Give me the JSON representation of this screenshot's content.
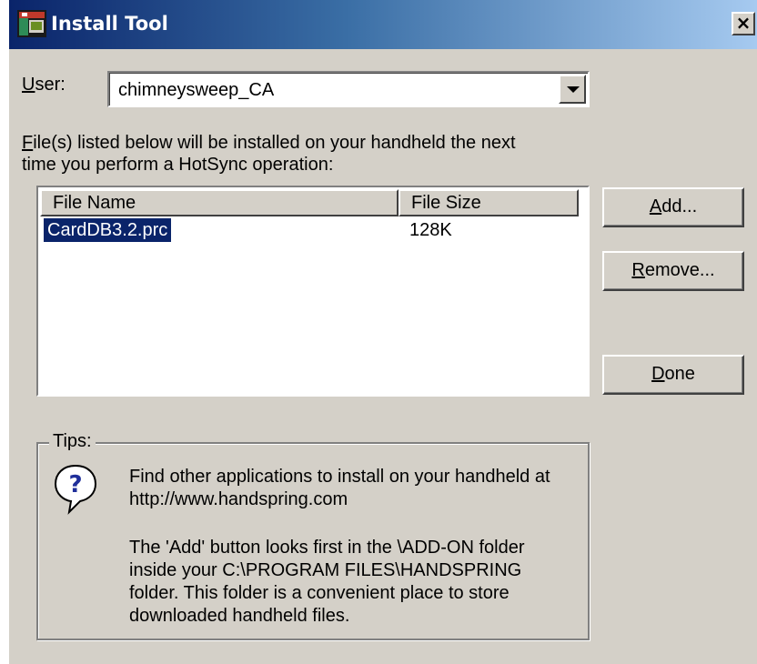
{
  "window": {
    "title": "Install Tool",
    "close_label": "×"
  },
  "user": {
    "label_underlined": "U",
    "label_rest": "ser:",
    "selected_value": "chimneysweep_CA"
  },
  "instructions": {
    "underlined": "F",
    "line1_rest": "ile(s) listed below will be installed on your handheld the next",
    "line2": "time you perform a HotSync operation:"
  },
  "file_list": {
    "columns": [
      "File Name",
      "File Size"
    ],
    "rows": [
      {
        "name": "CardDB3.2.prc",
        "size": "128K",
        "selected": true
      }
    ]
  },
  "buttons": {
    "add": {
      "underlined": "A",
      "rest": "dd..."
    },
    "remove": {
      "underlined": "R",
      "rest": "emove..."
    },
    "done": {
      "underlined": "D",
      "rest": "one"
    }
  },
  "tips": {
    "label": "Tips:",
    "paragraph1": [
      "Find other applications to install on your handheld at",
      "http://www.handspring.com"
    ],
    "paragraph2": [
      "The 'Add' button looks first in the \\ADD-ON folder",
      "inside your C:\\PROGRAM FILES\\HANDSPRING",
      "folder. This folder is a convenient place to store",
      "downloaded handheld files."
    ]
  },
  "colors": {
    "titlebar_start": "#0a246a",
    "titlebar_end": "#a6caf0",
    "dialog_face": "#d4d0c8",
    "selection": "#0a246a"
  },
  "icons": {
    "app": "palm-handheld-icon",
    "tip": "question-balloon-icon",
    "close": "close-icon",
    "dropdown": "chevron-down-icon"
  }
}
